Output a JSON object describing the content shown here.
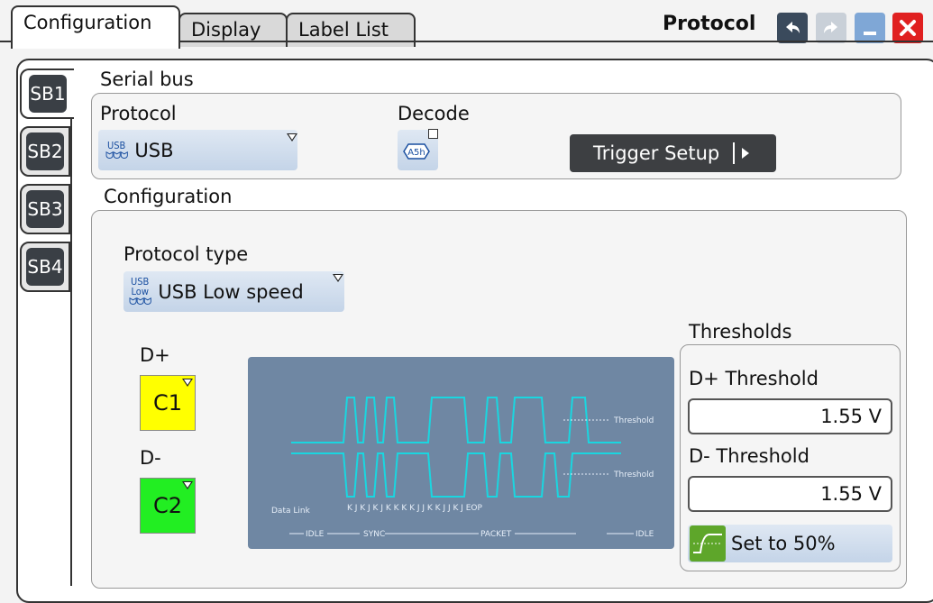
{
  "tabs": [
    {
      "label": "Configuration",
      "active": true
    },
    {
      "label": "Display",
      "active": false
    },
    {
      "label": "Label List",
      "active": false
    }
  ],
  "title": {
    "text": "Protocol",
    "buttons": [
      "undo-icon",
      "redo-icon",
      "minimize-icon",
      "close-icon"
    ]
  },
  "side_tabs": [
    {
      "label": "SB1",
      "active": true
    },
    {
      "label": "SB2",
      "active": false
    },
    {
      "label": "SB3",
      "active": false
    },
    {
      "label": "SB4",
      "active": false
    }
  ],
  "serial_bus": {
    "title": "Serial bus",
    "protocol_label": "Protocol",
    "protocol_value": "USB",
    "protocol_icon_text": "USB",
    "decode_label": "Decode",
    "decode_icon_text": "A5h",
    "trigger_setup_label": "Trigger Setup"
  },
  "configuration": {
    "title": "Configuration",
    "protocol_type_label": "Protocol type",
    "protocol_type_value": "USB Low speed",
    "protocol_type_icon_line1": "USB",
    "protocol_type_icon_line2": "Low"
  },
  "channels": {
    "dplus_label": "D+",
    "dplus_source": "C1",
    "dplus_color": "#ffff00",
    "dminus_label": "D-",
    "dminus_source": "C2",
    "dminus_color": "#22ee22"
  },
  "diagram": {
    "threshold_label": "Threshold",
    "data_link_label": "Data Link",
    "symbols": "K J K J K J K K K K J J K K J J K J EOP",
    "idle_label": "IDLE",
    "sync_label": "SYNC",
    "packet_label": "PACKET",
    "trace_color": "#1ad6e0"
  },
  "thresholds": {
    "title": "Thresholds",
    "dplus_label": "D+ Threshold",
    "dplus_value": "1.55 V",
    "dminus_label": "D- Threshold",
    "dminus_value": "1.55 V",
    "set50_label": "Set to 50%"
  }
}
